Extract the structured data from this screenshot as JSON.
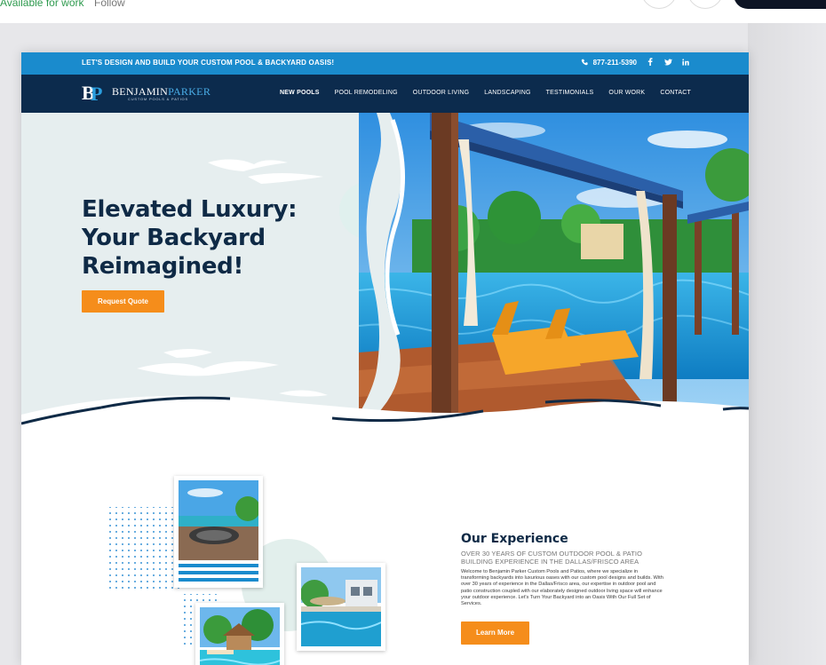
{
  "topbar": {
    "status": "Available for work",
    "follow": "Follow"
  },
  "site": {
    "promo": {
      "text": "LET'S DESIGN AND BUILD YOUR CUSTOM POOL & BACKYARD OASIS!",
      "phone": "877-211-5390",
      "icons": [
        "phone-icon",
        "facebook-icon",
        "twitter-icon",
        "linkedin-icon"
      ]
    },
    "logo": {
      "initial_b": "B",
      "initial_p": "P",
      "name_first": "BENJAMIN",
      "name_last": "PARKER",
      "tagline": "CUSTOM POOLS & PATIOS"
    },
    "nav": {
      "items": [
        "NEW POOLS",
        "POOL REMODELING",
        "OUTDOOR LIVING",
        "LANDSCAPING",
        "TESTIMONIALS",
        "OUR WORK",
        "CONTACT"
      ]
    },
    "hero": {
      "title_line1": "Elevated Luxury:",
      "title_line2": "Your Backyard",
      "title_line3": "Reimagined!",
      "cta": "Request Quote"
    },
    "experience": {
      "title": "Our Experience",
      "subtitle": "OVER 30 YEARS OF CUSTOM OUTDOOR POOL & PATIO BUILDING EXPERIENCE IN THE DALLAS/FRISCO AREA",
      "body": "Welcome to Benjamin Parker Custom Pools and Patios, where we specialize in transforming backyards into luxurious oases with our custom pool designs and builds. With over 30 years of experience in the Dallas/Frisco area, our expertise in outdoor pool and patio construction coupled with our elaborately designed outdoor living space will enhance your outdoor experience. Let's Turn Your Backyard into an Oasis With Our Full Set of Services.",
      "cta": "Learn More"
    }
  },
  "colors": {
    "promo_blue": "#1a8bcd",
    "nav_navy": "#0c2b4d",
    "accent_orange": "#f58d1b",
    "heading_navy": "#0f2a46"
  }
}
